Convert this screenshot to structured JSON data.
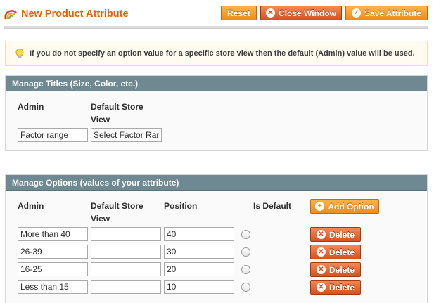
{
  "header": {
    "title": "New Product Attribute",
    "buttons": {
      "reset": "Reset",
      "close": "Close Window",
      "save": "Save Attribute"
    }
  },
  "notice": {
    "text": "If you do not specify an option value for a specific store view then the default (Admin) value will be used."
  },
  "titles": {
    "heading": "Manage Titles (Size, Color, etc.)",
    "col_admin": "Admin",
    "col_store": "Default Store View",
    "admin_value": "Factor range",
    "store_value": "Select Factor Range"
  },
  "options": {
    "heading": "Manage Options (values of your attribute)",
    "col_admin": "Admin",
    "col_store": "Default Store View",
    "col_position": "Position",
    "col_default": "Is Default",
    "add_label": "Add Option",
    "delete_label": "Delete",
    "rows": [
      {
        "admin": "More than 40",
        "store": "",
        "position": "40"
      },
      {
        "admin": "26-39",
        "store": "",
        "position": "30"
      },
      {
        "admin": "16-25",
        "store": "",
        "position": "20"
      },
      {
        "admin": "Less than 15",
        "store": "",
        "position": "10"
      }
    ]
  },
  "colors": {
    "accent": "#eb5e00",
    "button": "#f28d16",
    "delete_button": "#d8511d",
    "panel_header": "#6f8992"
  }
}
